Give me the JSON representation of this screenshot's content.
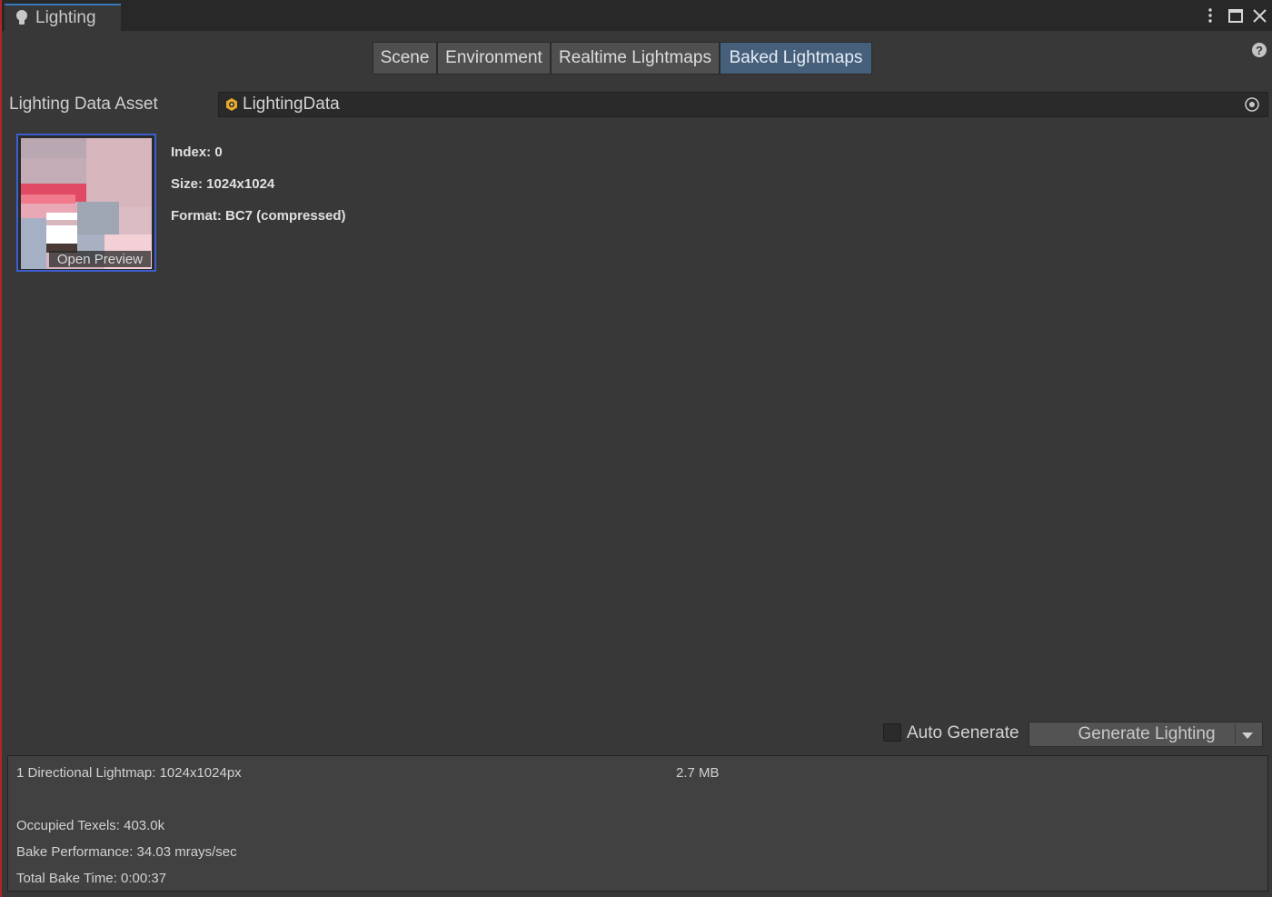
{
  "window": {
    "tab_title": "Lighting",
    "tab_icon": "lightbulb-icon",
    "controls": [
      "more-options-icon",
      "maximize-icon",
      "close-icon"
    ],
    "help_icon": "help-icon"
  },
  "toolbar": {
    "tabs": [
      {
        "label": "Scene",
        "active": false
      },
      {
        "label": "Environment",
        "active": false
      },
      {
        "label": "Realtime Lightmaps",
        "active": false
      },
      {
        "label": "Baked Lightmaps",
        "active": true
      }
    ]
  },
  "asset": {
    "label": "Lighting Data Asset",
    "value": "LightingData",
    "icon": "lighting-data-icon",
    "picker_icon": "object-picker-icon"
  },
  "lightmap": {
    "open_preview": "Open Preview",
    "index": "Index: 0",
    "size": "Size: 1024x1024",
    "format": "Format: BC7 (compressed)"
  },
  "footer": {
    "auto_generate_label": "Auto Generate",
    "auto_generate_checked": false,
    "generate_button": "Generate Lighting",
    "generate_dropdown_icon": "chevron-down-icon"
  },
  "stats": {
    "directional": "1 Directional Lightmap: 1024x1024px",
    "memory": "2.7 MB",
    "texels": "Occupied Texels: 403.0k",
    "performance": "Bake Performance: 34.03 mrays/sec",
    "bake_time": "Total Bake Time: 0:00:37"
  },
  "colors": {
    "accent": "#3a79bb",
    "active_tab": "#46607c",
    "background": "#383838",
    "selection_border": "#3c5fd0"
  }
}
